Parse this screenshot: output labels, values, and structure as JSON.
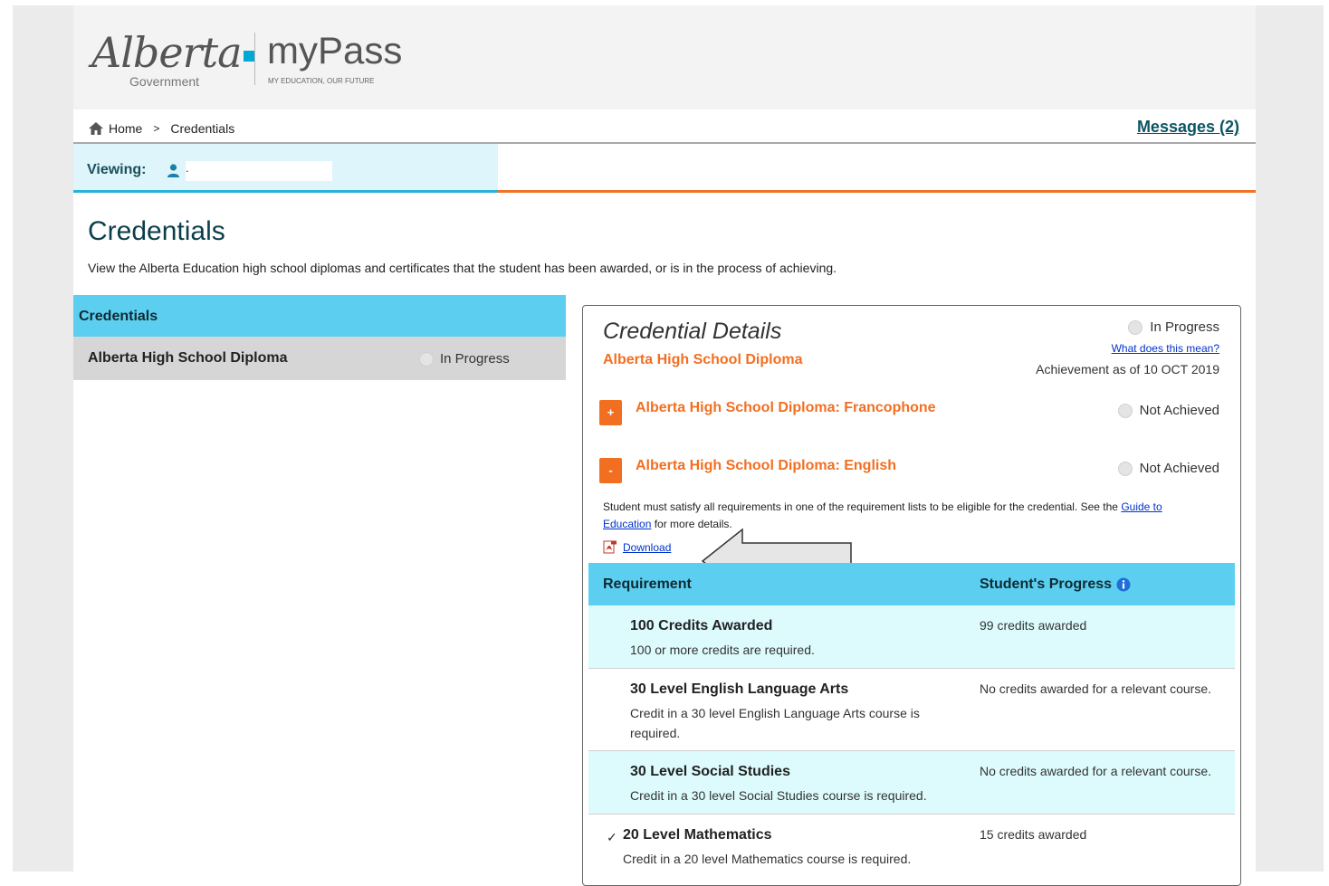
{
  "header": {
    "logo_alberta": "Alberta",
    "logo_government": "Government",
    "logo_mypass": "myPass",
    "logo_tagline": "MY EDUCATION, OUR FUTURE"
  },
  "breadcrumb": {
    "home": "Home",
    "separator": ">",
    "current": "Credentials"
  },
  "messages_link": "Messages (2)",
  "viewing": {
    "label": "Viewing:",
    "name": "."
  },
  "page": {
    "title": "Credentials",
    "description": "View the Alberta Education high school diplomas and certificates that the student has been awarded, or is in the process of achieving."
  },
  "left_panel": {
    "heading": "Credentials",
    "items": [
      {
        "label": "Alberta High School Diploma",
        "status": "In Progress"
      }
    ]
  },
  "details": {
    "title": "Credential Details",
    "subtitle": "Alberta High School Diploma",
    "status": "In Progress",
    "what_link": "What does this mean?",
    "achievement_as_of": "Achievement as of 10 OCT 2019",
    "options": [
      {
        "toggle": "+",
        "label": "Alberta High School Diploma: Francophone",
        "status": "Not Achieved"
      },
      {
        "toggle": "-",
        "label": "Alberta High School Diploma: English",
        "status": "Not Achieved"
      }
    ],
    "note_prefix": "Student must satisfy all requirements in one of the requirement lists to be eligible for the credential. See the ",
    "note_link": "Guide to Education",
    "note_suffix": " for more details.",
    "download_label": "Download",
    "table": {
      "col_requirement": "Requirement",
      "col_progress": "Student's Progress",
      "rows": [
        {
          "check": "",
          "title": "100 Credits Awarded",
          "desc": "100 or more credits are required.",
          "progress": "99 credits awarded"
        },
        {
          "check": "",
          "title": "30 Level English Language Arts",
          "desc": "Credit in a 30 level English Language Arts course is required.",
          "progress": "No credits awarded for a relevant course."
        },
        {
          "check": "",
          "title": "30 Level Social Studies",
          "desc": "Credit in a 30 level Social Studies course is required.",
          "progress": "No credits awarded for a relevant course."
        },
        {
          "check": "✓",
          "title": "20 Level Mathematics",
          "desc": "Credit in a 20 level Mathematics course is required.",
          "progress": "15 credits awarded"
        }
      ]
    }
  },
  "colors": {
    "accent_blue": "#5ccff0",
    "accent_orange": "#f26f21",
    "dark_teal": "#0b3e4b"
  },
  "icons": [
    "home-icon",
    "person-icon",
    "pdf-icon",
    "info-icon",
    "radio-icon"
  ]
}
